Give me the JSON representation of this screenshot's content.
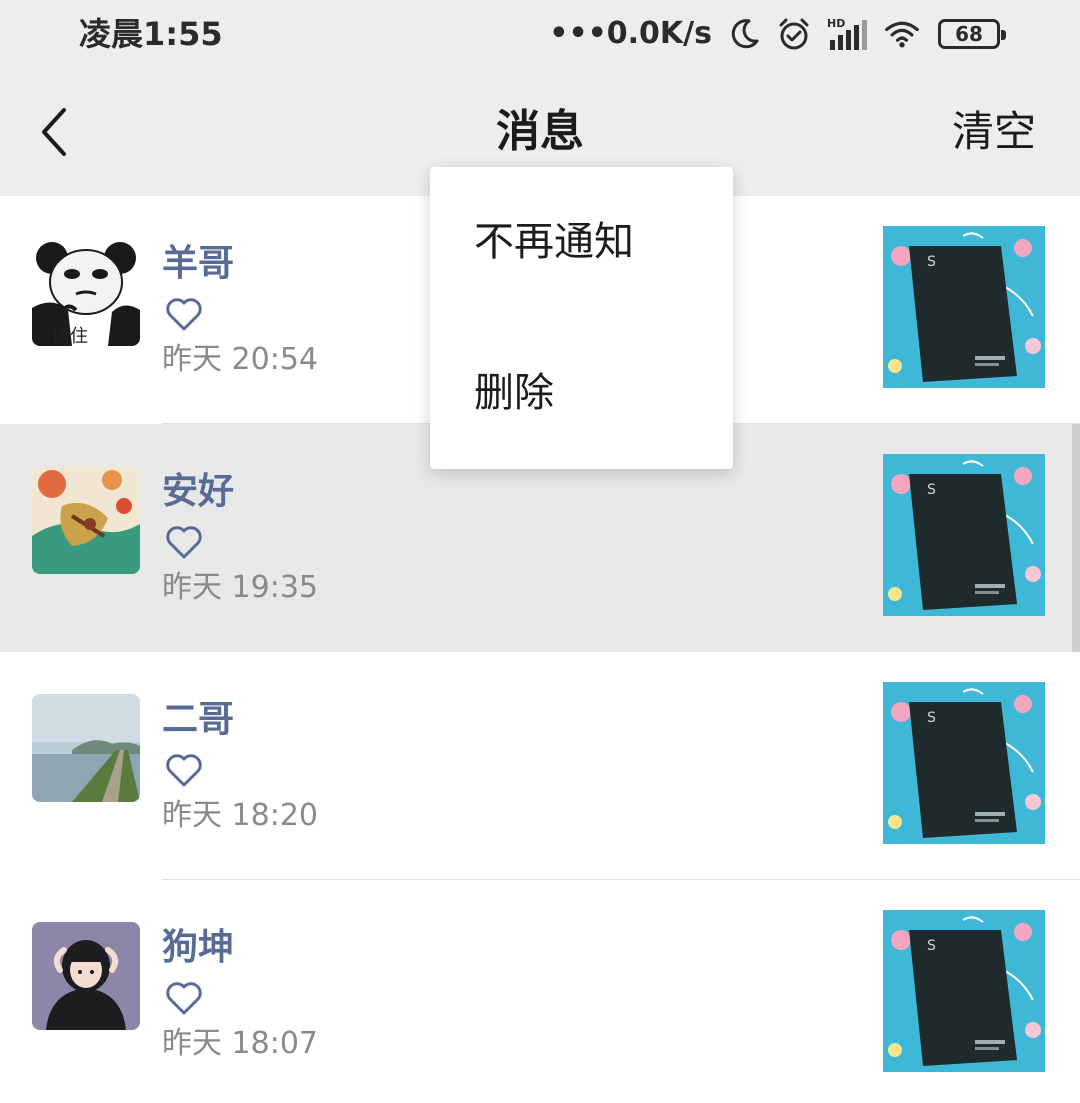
{
  "status_bar": {
    "time": "凌晨1:55",
    "network_speed": "•••0.0K/s",
    "hd_label": "HD",
    "battery": "68",
    "icons": [
      "moon-icon",
      "alarm-icon",
      "signal-icon",
      "wifi-icon",
      "battery-icon"
    ]
  },
  "header": {
    "back_icon": "chevron-left-icon",
    "title": "消息",
    "clear_label": "清空"
  },
  "messages": [
    {
      "user": "羊哥",
      "avatar_caption": "愣住",
      "like_icon": "heart-outline-icon",
      "time": "昨天 20:54"
    },
    {
      "user": "安好",
      "like_icon": "heart-outline-icon",
      "time": "昨天 19:35",
      "highlighted": true
    },
    {
      "user": "二哥",
      "like_icon": "heart-outline-icon",
      "time": "昨天 18:20"
    },
    {
      "user": "狗坤",
      "like_icon": "heart-outline-icon",
      "time": "昨天 18:07"
    }
  ],
  "popup_menu": {
    "items": [
      {
        "label": "不再通知"
      },
      {
        "label": "删除"
      }
    ]
  },
  "colors": {
    "bar_background": "#ededed",
    "username": "#576b95",
    "timestamp": "#8a8a8a",
    "highlight_row": "#e8e8e8"
  }
}
